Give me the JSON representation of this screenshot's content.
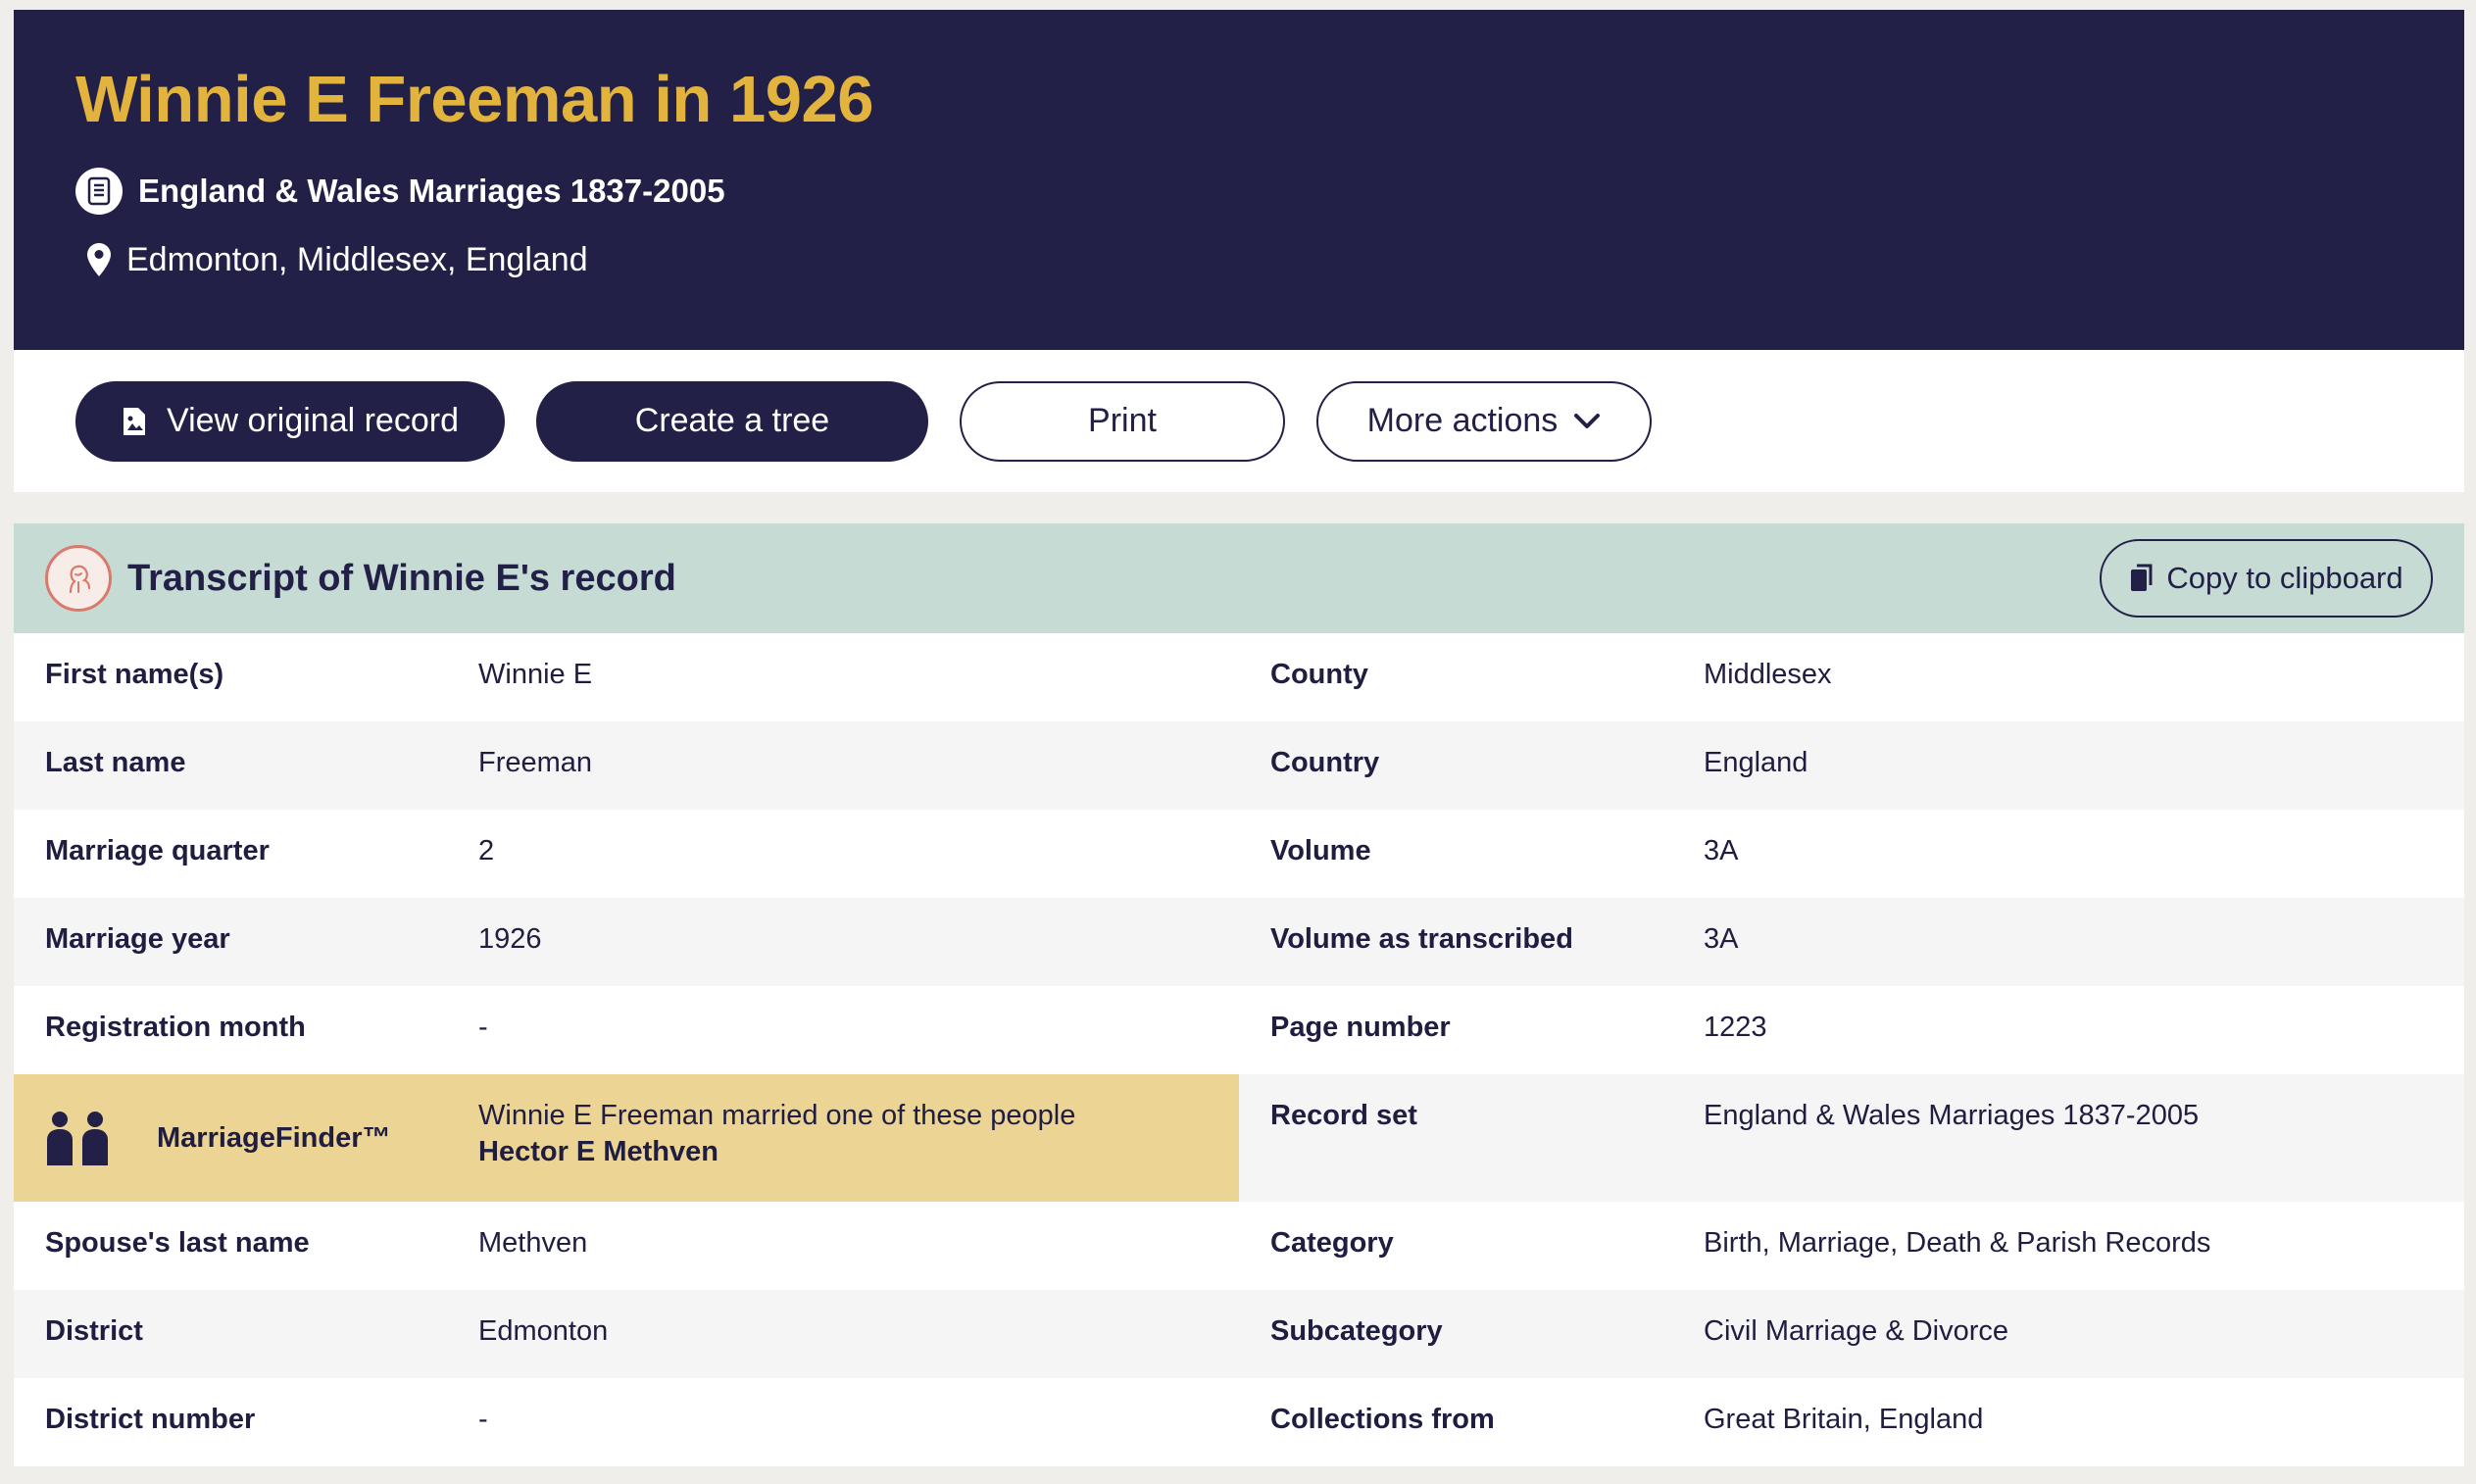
{
  "header": {
    "title": "Winnie E Freeman in 1926",
    "record_set": "England & Wales Marriages 1837-2005",
    "place": "Edmonton, Middlesex, England",
    "icons": [
      "document-icon",
      "location-pin-icon"
    ]
  },
  "actions": {
    "view_original": "View original record",
    "create_tree": "Create a tree",
    "print": "Print",
    "more_actions": "More actions"
  },
  "transcript": {
    "title": "Transcript of Winnie E's record",
    "copy_label": "Copy to clipboard",
    "left": [
      {
        "label": "First name(s)",
        "value": "Winnie E"
      },
      {
        "label": "Last name",
        "value": "Freeman"
      },
      {
        "label": "Marriage quarter",
        "value": "2"
      },
      {
        "label": "Marriage year",
        "value": "1926"
      },
      {
        "label": "Registration month",
        "value": "-"
      },
      {
        "label": "MarriageFinder™",
        "value": "Winnie E Freeman married one of these people",
        "spouse": "Hector E Methven"
      },
      {
        "label": "Spouse's last name",
        "value": "Methven"
      },
      {
        "label": "District",
        "value": "Edmonton"
      },
      {
        "label": "District number",
        "value": "-"
      }
    ],
    "right": [
      {
        "label": "County",
        "value": "Middlesex"
      },
      {
        "label": "Country",
        "value": "England"
      },
      {
        "label": "Volume",
        "value": "3A"
      },
      {
        "label": "Volume as transcribed",
        "value": "3A"
      },
      {
        "label": "Page number",
        "value": "1223"
      },
      {
        "label": "Record set",
        "value": "England & Wales Marriages 1837-2005"
      },
      {
        "label": "Category",
        "value": "Birth, Marriage, Death & Parish Records"
      },
      {
        "label": "Subcategory",
        "value": "Civil Marriage & Divorce"
      },
      {
        "label": "Collections from",
        "value": "Great Britain, England"
      }
    ]
  },
  "colors": {
    "navy": "#232047",
    "gold": "#e2b33d",
    "mint": "#c5dbd4",
    "highlight": "#ecd495"
  }
}
